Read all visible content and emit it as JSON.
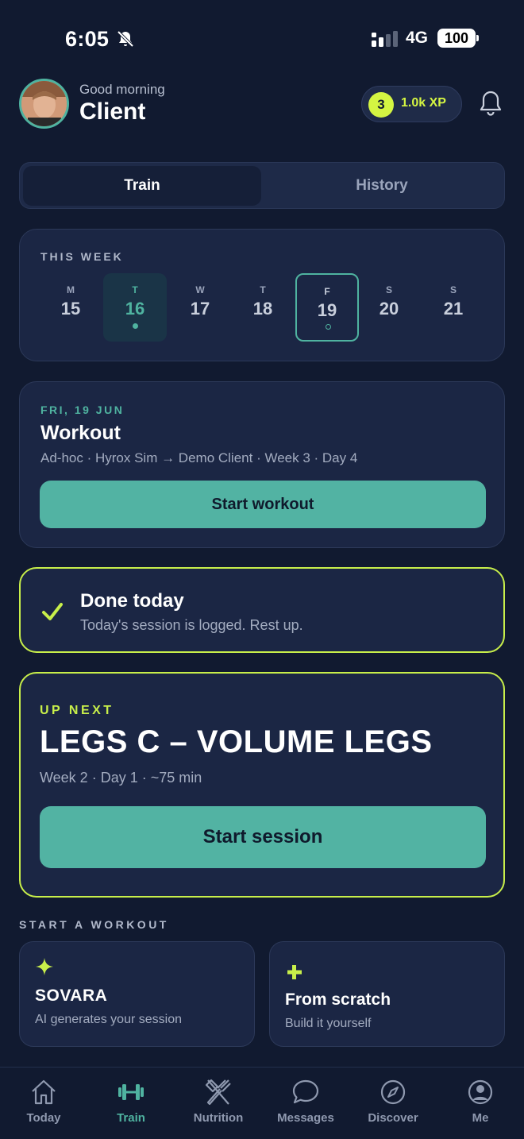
{
  "status_bar": {
    "time": "6:05",
    "network": "4G",
    "battery": "100"
  },
  "header": {
    "greeting": "Good morning",
    "name": "Client",
    "xp_level": "3",
    "xp_text": "1.0k XP"
  },
  "tabs": [
    {
      "label": "Train",
      "active": true
    },
    {
      "label": "History",
      "active": false
    }
  ],
  "week": {
    "label": "THIS WEEK",
    "days": [
      {
        "letter": "M",
        "num": "15"
      },
      {
        "letter": "T",
        "num": "16",
        "today": true
      },
      {
        "letter": "W",
        "num": "17"
      },
      {
        "letter": "T",
        "num": "18"
      },
      {
        "letter": "F",
        "num": "19",
        "selected": true
      },
      {
        "letter": "S",
        "num": "20"
      },
      {
        "letter": "S",
        "num": "21"
      }
    ]
  },
  "workout": {
    "date": "FRI, 19 JUN",
    "title": "Workout",
    "subtitle": "Ad-hoc · Hyrox Sim → Demo Client · Week 3 · Day 4",
    "button": "Start workout"
  },
  "done": {
    "title": "Done today",
    "subtitle": "Today's session is logged. Rest up."
  },
  "up_next": {
    "label": "UP NEXT",
    "title": "LEGS C – VOLUME LEGS",
    "subtitle": "Week 2 · Day 1 · ~75 min",
    "button": "Start session"
  },
  "start_workout": {
    "label": "START A WORKOUT",
    "options": [
      {
        "title": "SOVARA",
        "subtitle": "AI generates your session",
        "icon": "sparkle-icon"
      },
      {
        "title": "From scratch",
        "subtitle": "Build it yourself",
        "icon": "plus-icon"
      }
    ]
  },
  "nav": [
    {
      "label": "Today",
      "icon": "home-icon"
    },
    {
      "label": "Train",
      "icon": "dumbbell-icon",
      "active": true
    },
    {
      "label": "Nutrition",
      "icon": "fork-knife-icon"
    },
    {
      "label": "Messages",
      "icon": "chat-icon"
    },
    {
      "label": "Discover",
      "icon": "compass-icon"
    },
    {
      "label": "Me",
      "icon": "person-icon"
    }
  ],
  "colors": {
    "accent": "#4fb3a0",
    "highlight": "#c8ef4a",
    "background": "#111a30",
    "card": "#1b2644"
  }
}
